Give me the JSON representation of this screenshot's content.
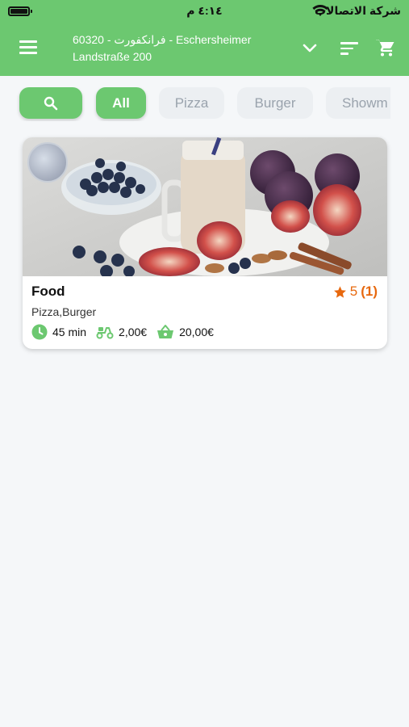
{
  "status": {
    "time": "٤:١٤ م",
    "carrier": "شركة الاتصالات"
  },
  "header": {
    "address_line1": "60320 - فرانكفورت - Eschersheimer",
    "address_line2": "Landstraße 200"
  },
  "filters": {
    "items": [
      "All",
      "Pizza",
      "Burger",
      "Showm"
    ]
  },
  "restaurant": {
    "name": "Food",
    "rating": "5",
    "review_count": "(1)",
    "tags": "Pizza,Burger",
    "delivery_time": "45 min",
    "delivery_fee": "2,00€",
    "min_order": "20,00€"
  },
  "colors": {
    "primary": "#6cc870",
    "accent": "#e7680e",
    "background": "#f5f7f9"
  },
  "icons": [
    "menu-icon",
    "chevron-down-icon",
    "sort-icon",
    "cart-icon",
    "search-icon",
    "clock-icon",
    "scooter-icon",
    "basket-icon",
    "star-icon"
  ]
}
